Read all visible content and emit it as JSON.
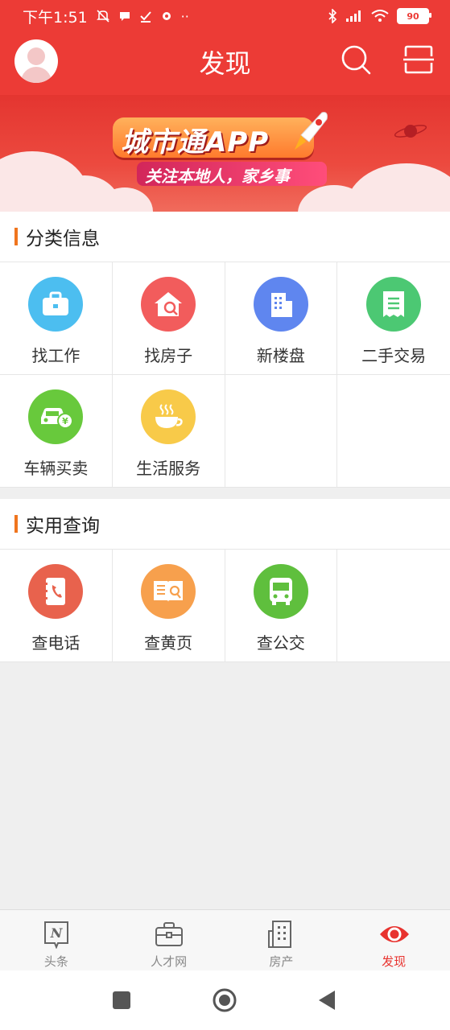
{
  "status": {
    "time": "下午1:51",
    "battery": "90",
    "icons": [
      "mute-icon",
      "chat-icon",
      "check-icon",
      "settings-icon",
      "more-dots-icon",
      "bluetooth-icon",
      "signal-icon",
      "wifi-icon",
      "battery-icon"
    ]
  },
  "header": {
    "title": "发现",
    "icons": [
      "avatar",
      "search-icon",
      "scan-icon"
    ]
  },
  "banner": {
    "logo": "城市通APP",
    "slogan": "关注本地人，家乡事"
  },
  "sections": [
    {
      "title": "分类信息",
      "items": [
        {
          "label": "找工作",
          "icon": "briefcase-icon",
          "color": "#4cbef0"
        },
        {
          "label": "找房子",
          "icon": "house-search-icon",
          "color": "#f25c5c"
        },
        {
          "label": "新楼盘",
          "icon": "building-icon",
          "color": "#5f86ef"
        },
        {
          "label": "二手交易",
          "icon": "receipt-icon",
          "color": "#4cc873"
        },
        {
          "label": "车辆买卖",
          "icon": "car-yen-icon",
          "color": "#68c93c"
        },
        {
          "label": "生活服务",
          "icon": "coffee-cup-icon",
          "color": "#f8ca49"
        }
      ]
    },
    {
      "title": "实用查询",
      "items": [
        {
          "label": "查电话",
          "icon": "phonebook-icon",
          "color": "#e8624d"
        },
        {
          "label": "查黄页",
          "icon": "yellow-pages-icon",
          "color": "#f7a04d"
        },
        {
          "label": "查公交",
          "icon": "bus-icon",
          "color": "#5fbf3d"
        }
      ]
    }
  ],
  "tabs": [
    {
      "label": "头条",
      "icon": "news-icon"
    },
    {
      "label": "人才网",
      "icon": "briefcase-tab-icon"
    },
    {
      "label": "房产",
      "icon": "building-tab-icon"
    },
    {
      "label": "发现",
      "icon": "eye-icon",
      "active": true
    }
  ],
  "colors": {
    "accent": "#ec3b36",
    "section_bar": "#f0751e",
    "active_tab": "#e8332f"
  },
  "system_nav": [
    "recents-button",
    "home-button",
    "back-button"
  ]
}
